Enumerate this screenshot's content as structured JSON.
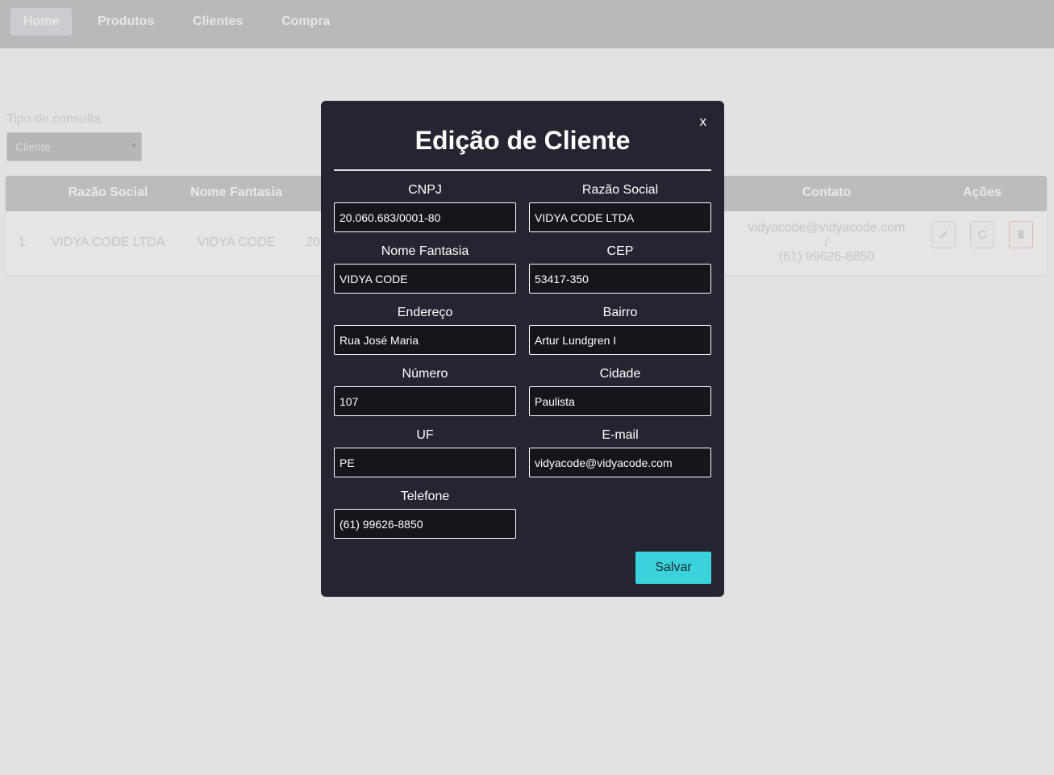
{
  "nav": {
    "items": [
      {
        "label": "Home"
      },
      {
        "label": "Produtos"
      },
      {
        "label": "Clientes"
      },
      {
        "label": "Compra"
      }
    ]
  },
  "query": {
    "label": "Tipo de consulta",
    "selected": "Cliente"
  },
  "table": {
    "headers": {
      "razao_social": "Razão Social",
      "nome_fantasia": "Nome Fantasia",
      "contato": "Contato",
      "acoes": "Ações"
    },
    "row": {
      "index": "1",
      "razao_social": "VIDYA CODE LTDA",
      "nome_fantasia": "VIDYA CODE",
      "cnpj_partial": "20",
      "contato_email": "vidyacode@vidyacode.com",
      "contato_sep": "/",
      "contato_phone": "(61) 99626-8850"
    },
    "actions": {
      "edit_icon": "pencil-icon",
      "refresh_icon": "refresh-icon",
      "delete_icon": "trash-icon"
    }
  },
  "modal": {
    "close_label": "x",
    "title": "Edição de Cliente",
    "fields": {
      "cnpj": {
        "label": "CNPJ",
        "value": "20.060.683/0001-80"
      },
      "razao_social": {
        "label": "Razão Social",
        "value": "VIDYA CODE LTDA"
      },
      "nome_fantasia": {
        "label": "Nome Fantasia",
        "value": "VIDYA CODE"
      },
      "cep": {
        "label": "CEP",
        "value": "53417-350"
      },
      "endereco": {
        "label": "Endereço",
        "value": "Rua José Maria"
      },
      "bairro": {
        "label": "Bairro",
        "value": "Artur Lundgren I"
      },
      "numero": {
        "label": "Número",
        "value": "107"
      },
      "cidade": {
        "label": "Cidade",
        "value": "Paulista"
      },
      "uf": {
        "label": "UF",
        "value": "PE"
      },
      "email": {
        "label": "E-mail",
        "value": "vidyacode@vidyacode.com"
      },
      "telefone": {
        "label": "Telefone",
        "value": "(61) 99626-8850"
      }
    },
    "save_label": "Salvar"
  },
  "colors": {
    "modal_bg": "#252531",
    "accent": "#3ad2dc",
    "input_bg": "#15161b"
  }
}
